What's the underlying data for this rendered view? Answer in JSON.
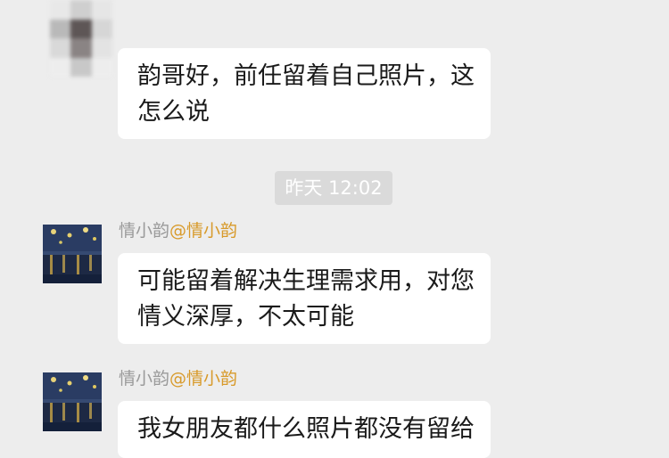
{
  "colors": {
    "background": "#ededed",
    "bubble": "#ffffff",
    "timestamp_bg": "#dadada",
    "nickname": "#9a9a9a",
    "mention": "#d89a2a"
  },
  "messages": [
    {
      "sender_avatar": "blurred-avatar",
      "lines": [
        "韵哥好，前任留着自己照片，这",
        "怎么说"
      ]
    }
  ],
  "timestamp": "昨天 12:02",
  "replies": [
    {
      "sender_avatar": "starry-night-avatar",
      "nickname": "情小韵",
      "mention": "@情小韵",
      "lines": [
        "可能留着解决生理需求用，对您",
        "情义深厚，不太可能"
      ]
    },
    {
      "sender_avatar": "starry-night-avatar",
      "nickname": "情小韵",
      "mention": "@情小韵",
      "lines": [
        "我女朋友都什么照片都没有留给"
      ]
    }
  ]
}
